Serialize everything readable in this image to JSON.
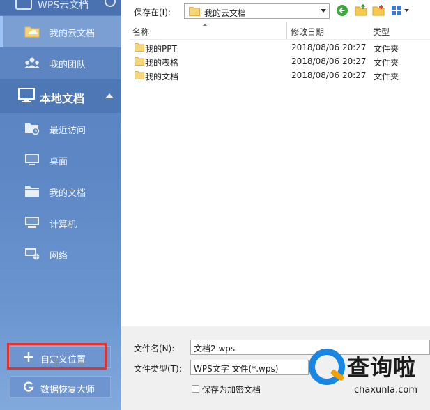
{
  "sidebar": {
    "title": "WPS云文档",
    "cloud_items": [
      {
        "label": "我的云文档",
        "icon": "cloud-folder-icon"
      },
      {
        "label": "我的团队",
        "icon": "team-icon"
      }
    ],
    "section": {
      "label": "本地文档",
      "icon": "monitor-icon"
    },
    "local_items": [
      {
        "label": "最近访问",
        "icon": "recent-icon"
      },
      {
        "label": "桌面",
        "icon": "desktop-icon"
      },
      {
        "label": "我的文档",
        "icon": "documents-icon"
      },
      {
        "label": "计算机",
        "icon": "computer-icon"
      },
      {
        "label": "网络",
        "icon": "network-icon"
      }
    ],
    "buttons": {
      "custom_location": "自定义位置",
      "data_recovery": "数据恢复大师"
    }
  },
  "toolbar": {
    "save_in_label": "保存在(I):",
    "location": "我的云文档"
  },
  "file_list": {
    "columns": [
      "名称",
      "修改日期",
      "类型"
    ],
    "rows": [
      {
        "name": "我的PPT",
        "date": "2018/08/06 20:27",
        "type": "文件夹"
      },
      {
        "name": "我的表格",
        "date": "2018/08/06 20:27",
        "type": "文件夹"
      },
      {
        "name": "我的文档",
        "date": "2018/08/06 20:27",
        "type": "文件夹"
      }
    ]
  },
  "bottom": {
    "filename_label": "文件名(N):",
    "filename_value": "文档2.wps",
    "filetype_label": "文件类型(T):",
    "filetype_value": "WPS文字 文件(*.wps)",
    "encrypt_label": "保存为加密文档"
  },
  "watermark": {
    "text": "查询啦",
    "url": "chaxunla.com"
  },
  "colors": {
    "sidebar": "#5d87c4",
    "highlight_box": "#e0322f",
    "folder": "#f7d67a",
    "watermark_blue": "#1a86e3"
  }
}
